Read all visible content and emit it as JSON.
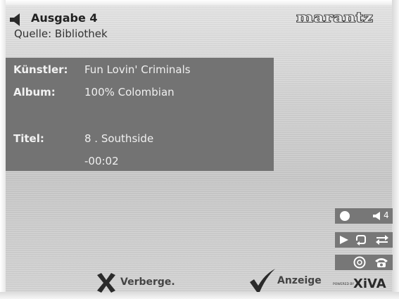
{
  "header": {
    "output_title": "Ausgabe 4",
    "source_line": "Quelle: Bibliothek",
    "brand": "marantz"
  },
  "track_info": {
    "artist_label": "Künstler:",
    "artist_value": "Fun Lovin' Criminals",
    "album_label": "Album:",
    "album_value": "100% Colombian",
    "title_label": "Titel:",
    "title_value": "8 . Southside",
    "time_value": "-00:02"
  },
  "controls": {
    "volume_value": "4",
    "icons": [
      "record-dot-icon",
      "speaker-icon",
      "play-icon",
      "repeat-icon",
      "shuffle-icon",
      "disc-icon",
      "phone-icon"
    ]
  },
  "footer": {
    "hide_label": "Verberge.",
    "display_label": "Anzeige",
    "powered_by": "POWERED BY",
    "xiva": "XiVA"
  },
  "colors": {
    "panel": "#737373",
    "button": "#777777",
    "text_dark": "#222222"
  }
}
